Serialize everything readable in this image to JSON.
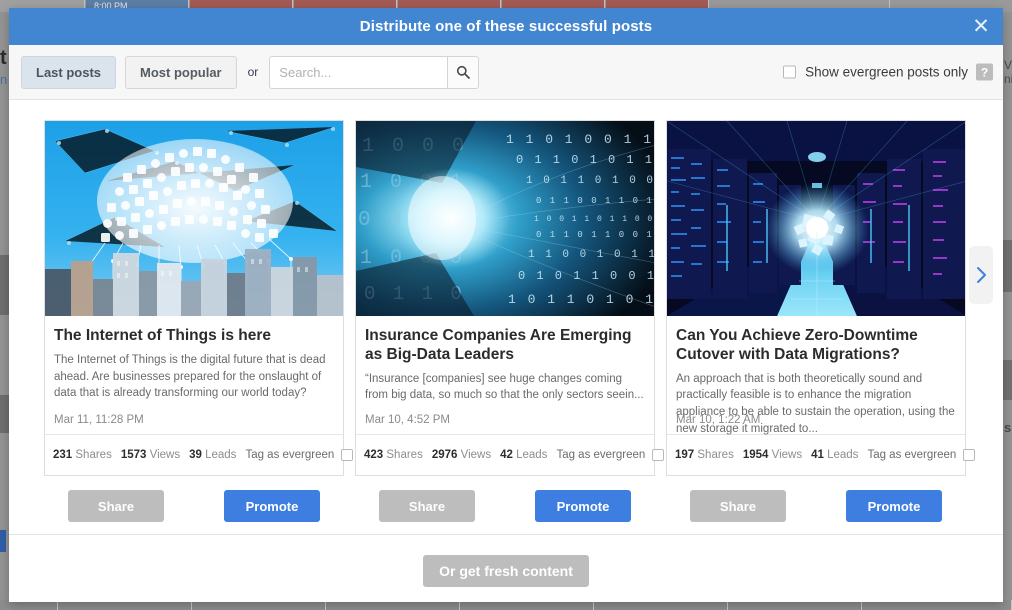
{
  "background": {
    "ghost_text_left": "t",
    "ghost_text_right_1": "V",
    "ghost_text_right_2": "ni",
    "ghost_text_right_3": "s",
    "top_strip_labels": [
      "8:00 PM",
      "",
      "",
      "",
      "",
      ""
    ]
  },
  "modal": {
    "title": "Distribute one of these successful posts",
    "close_icon": "close-icon",
    "close_label": "✕"
  },
  "toolbar": {
    "last_posts_label": "Last posts",
    "most_popular_label": "Most popular",
    "or_label": "or",
    "search_placeholder": "Search...",
    "search_value": "",
    "search_icon": "search-icon",
    "evergreen_label": "Show evergreen posts only",
    "evergreen_checked": false,
    "help_label": "?"
  },
  "carousel": {
    "next_icon": "chevron-right-icon",
    "cards": [
      {
        "image_name": "iot-cloud-city-image",
        "title": "The Internet of Things is here",
        "excerpt": "The Internet of Things is the digital future that is dead ahead. Are businesses prepared for the onslaught of data that is already transforming our world today?",
        "date": "Mar 11, 11:28 PM",
        "shares": "231",
        "shares_label": "Shares",
        "views": "1573",
        "views_label": "Views",
        "leads": "39",
        "leads_label": "Leads",
        "tag_label": "Tag as evergreen",
        "tag_checked": false,
        "share_label": "Share",
        "promote_label": "Promote"
      },
      {
        "image_name": "binary-data-tunnel-image",
        "title": "Insurance Companies Are Emerging as Big-Data Leaders",
        "excerpt": "“Insurance [companies] see huge changes coming from big data, so much so that the only sectors seein...",
        "date": "Mar 10, 4:52 PM",
        "shares": "423",
        "shares_label": "Shares",
        "views": "2976",
        "views_label": "Views",
        "leads": "42",
        "leads_label": "Leads",
        "tag_label": "Tag as evergreen",
        "tag_checked": false,
        "share_label": "Share",
        "promote_label": "Promote"
      },
      {
        "image_name": "data-center-server-room-image",
        "title": "Can You Achieve Zero-Downtime Cutover with Data Migrations?",
        "excerpt": "An approach that is both theoretically sound and practically feasible is to enhance the migration appliance to be able to sustain the operation, using the new storage it migrated to...",
        "date": "Mar 10, 1:22 AM",
        "shares": "197",
        "shares_label": "Shares",
        "views": "1954",
        "views_label": "Views",
        "leads": "41",
        "leads_label": "Leads",
        "tag_label": "Tag as evergreen",
        "tag_checked": false,
        "share_label": "Share",
        "promote_label": "Promote"
      }
    ]
  },
  "footer": {
    "fresh_content_label": "Or get fresh content"
  },
  "colors": {
    "accent_blue": "#4285d0",
    "promote_blue": "#3d7ee0",
    "share_gray": "#bdbdbd",
    "active_tab": "#dbe3ed"
  }
}
